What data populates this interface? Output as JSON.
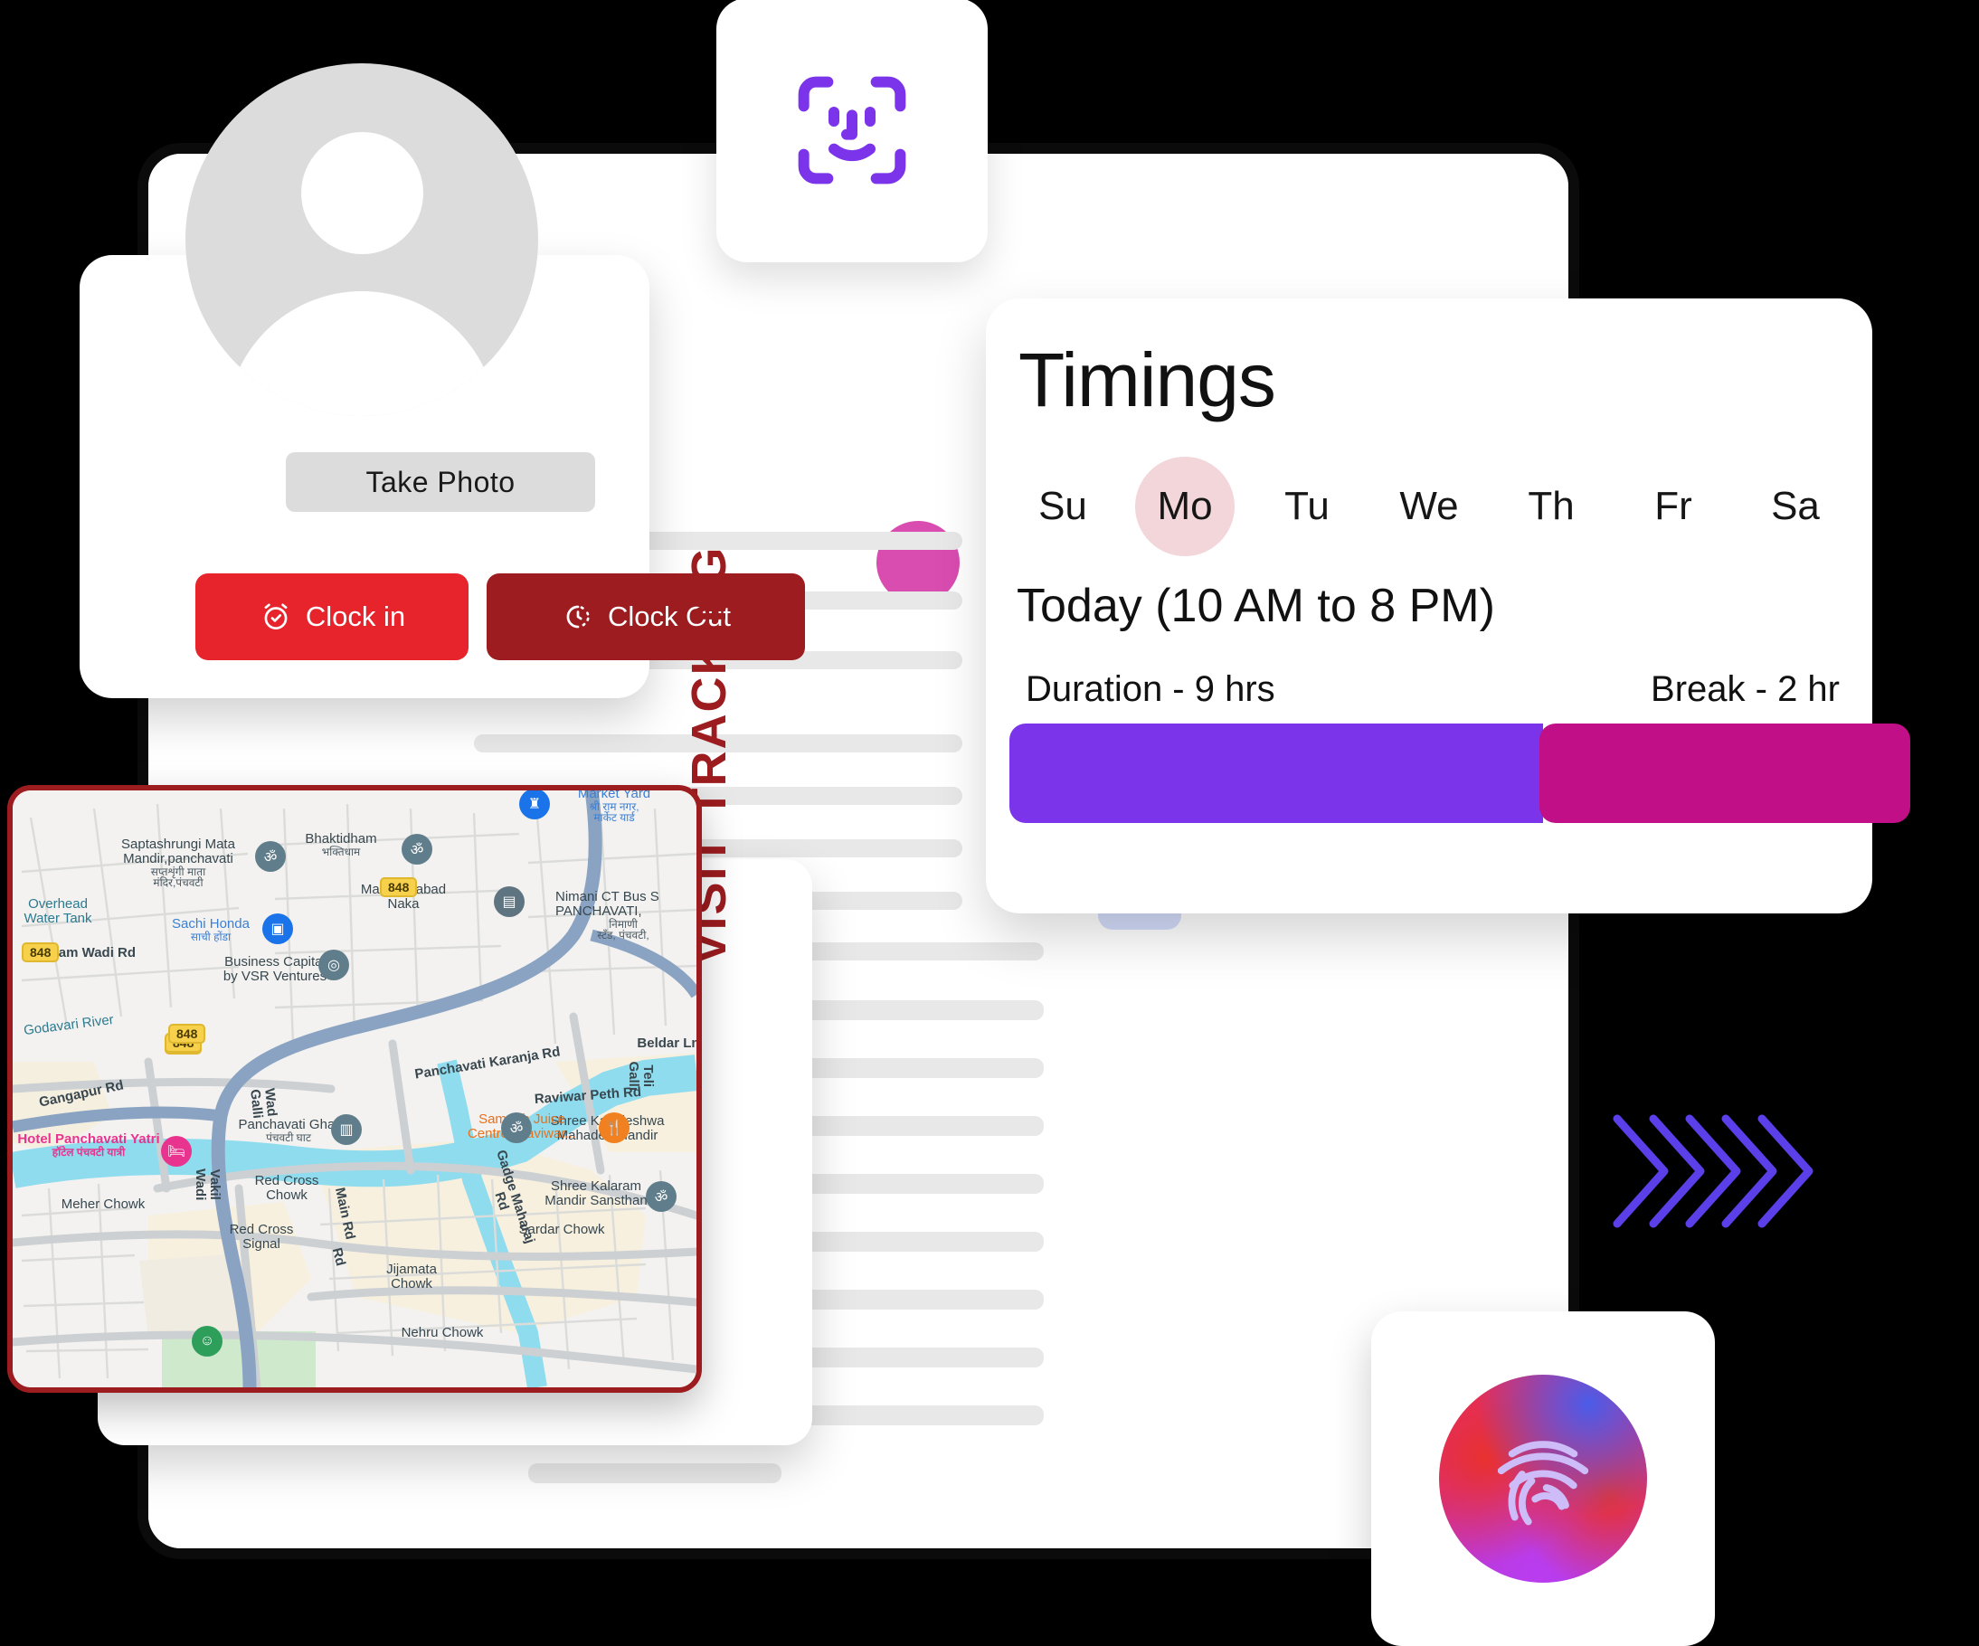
{
  "faceid": {
    "icon": "face-id-icon",
    "color": "#7c34ea"
  },
  "photo_card": {
    "avatar_icon": "user-avatar-icon",
    "take_photo_label": "Take  Photo",
    "clock_in_label": "Clock in",
    "clock_out_label": "Clock Out",
    "clock_in_icon": "alarm-check-icon",
    "clock_out_icon": "timer-dashed-icon",
    "clock_in_color": "#e7242b",
    "clock_out_color": "#9c1c1f"
  },
  "visit": {
    "label": "VISIT TRACKING",
    "label_color": "#9c1c1f"
  },
  "map": {
    "border_color": "#9c1c1f",
    "labels": [
      {
        "text": "Saptashrungi Mata",
        "sub": "Mandir,panchavati",
        "native": "सप्तशृंगी माता",
        "native2": "मंदिर,पंचवटी",
        "type": "place"
      },
      {
        "text": "Overhead",
        "sub": "Water Tank",
        "type": "water"
      },
      {
        "text": "Ram Wadi Rd",
        "type": "road"
      },
      {
        "text": "Sachi Honda",
        "native": "साची होंडा",
        "type": "poi-blue"
      },
      {
        "text": "Business Capital",
        "sub": "by VSR Ventures",
        "type": "place"
      },
      {
        "text": "Godavari River",
        "type": "water"
      },
      {
        "text": "Bhaktidham",
        "native": "भक्तिधाम",
        "type": "place"
      },
      {
        "text": "Makhmalabad",
        "sub": "Naka",
        "type": "place"
      },
      {
        "text": "Market Yard",
        "native": "श्री राम नगर,",
        "native2": "मार्केट यार्ड",
        "type": "poi-blue"
      },
      {
        "text": "Nimani CT Bus S",
        "sub": "PANCHAVATI,",
        "native": "निमाणी",
        "native2": "स्टँड, पंचवटी,",
        "type": "place"
      },
      {
        "text": "Panchavati Karanja Rd",
        "type": "road"
      },
      {
        "text": "Panchavati Ghat",
        "native": "पंचवटी घाट",
        "type": "place"
      },
      {
        "text": "Shree Kapaleshwa",
        "sub": "Mahadev Mandir",
        "type": "place"
      },
      {
        "text": "Shree Kalaram",
        "sub": "Mandir Sansthan",
        "type": "place"
      },
      {
        "text": "Beldar Ln",
        "type": "road"
      },
      {
        "text": "Teli Galli",
        "type": "road"
      },
      {
        "text": "Raviwar Peth Rd",
        "type": "road"
      },
      {
        "text": "Samarth Juice",
        "sub": "Centre (Raviwar...",
        "type": "poi-orange"
      },
      {
        "text": "Gangapur Rd",
        "type": "road"
      },
      {
        "text": "Hotel Panchavati Yatri",
        "native": "हॉटेल पंचवटी यात्री",
        "type": "poi-pink"
      },
      {
        "text": "Vakil Wadi",
        "type": "road"
      },
      {
        "text": "Red Cross",
        "sub": "Chowk",
        "type": "place"
      },
      {
        "text": "Red Cross",
        "sub": "Signal",
        "type": "place"
      },
      {
        "text": "Meher Chowk",
        "type": "place"
      },
      {
        "text": "Main Rd",
        "type": "road"
      },
      {
        "text": "Wad Galli",
        "type": "road"
      },
      {
        "text": "Gadge Maharaj Rd",
        "type": "road"
      },
      {
        "text": "Sardar Chowk",
        "type": "place"
      },
      {
        "text": "Jijamata",
        "sub": "Chowk",
        "type": "place"
      },
      {
        "text": "Nehru Chowk",
        "type": "place"
      },
      {
        "text": "Rd",
        "type": "road"
      }
    ],
    "highway_badges": [
      "848",
      "848",
      "848",
      "848"
    ]
  },
  "timings": {
    "title": "Timings",
    "days": [
      {
        "label": "Su",
        "active": false
      },
      {
        "label": "Mo",
        "active": true
      },
      {
        "label": "Tu",
        "active": false
      },
      {
        "label": "We",
        "active": false
      },
      {
        "label": "Th",
        "active": false
      },
      {
        "label": "Fr",
        "active": false
      },
      {
        "label": "Sa",
        "active": false
      }
    ],
    "today_text": "Today (10 AM to 8 PM)",
    "duration_label": "Duration - 9 hrs",
    "break_label": "Break - 2 hr",
    "duration_color": "#7c34ea",
    "break_color": "#c00f87",
    "active_day_color": "#f3d6d9"
  },
  "chevrons": {
    "count": 5,
    "color": "#5b3fe8",
    "icon": "chevron-right-icon"
  },
  "fingerprint": {
    "icon": "fingerprint-icon",
    "ridge_color": "#cdbcf7"
  }
}
